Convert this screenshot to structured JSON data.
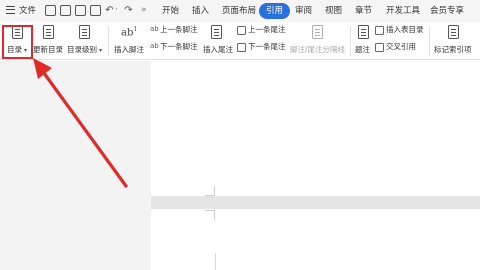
{
  "menubar": {
    "file_label": "文件",
    "tabs": [
      "开始",
      "插入",
      "页面布局",
      "引用",
      "审阅",
      "视图",
      "章节",
      "开发工具",
      "会员专享"
    ],
    "active_tab": "引用"
  },
  "ribbon": {
    "toc_label": "目录",
    "update_toc_label": "更新目录",
    "toc_level_label": "目录级别",
    "insert_footnote_label": "插入脚注",
    "prev_footnote_label": "上一条脚注",
    "next_footnote_label": "下一条脚注",
    "insert_endnote_label": "插入尾注",
    "prev_endnote_label": "上一条尾注",
    "next_endnote_label": "下一条尾注",
    "separator_label": "脚注/尾注分隔线",
    "caption_label": "题注",
    "insert_table_of_figures_label": "插入表目录",
    "cross_reference_label": "交叉引用",
    "mark_index_label": "标记索引项"
  },
  "colors": {
    "accent": "#2a6fdb",
    "highlight": "#e02a2a"
  }
}
